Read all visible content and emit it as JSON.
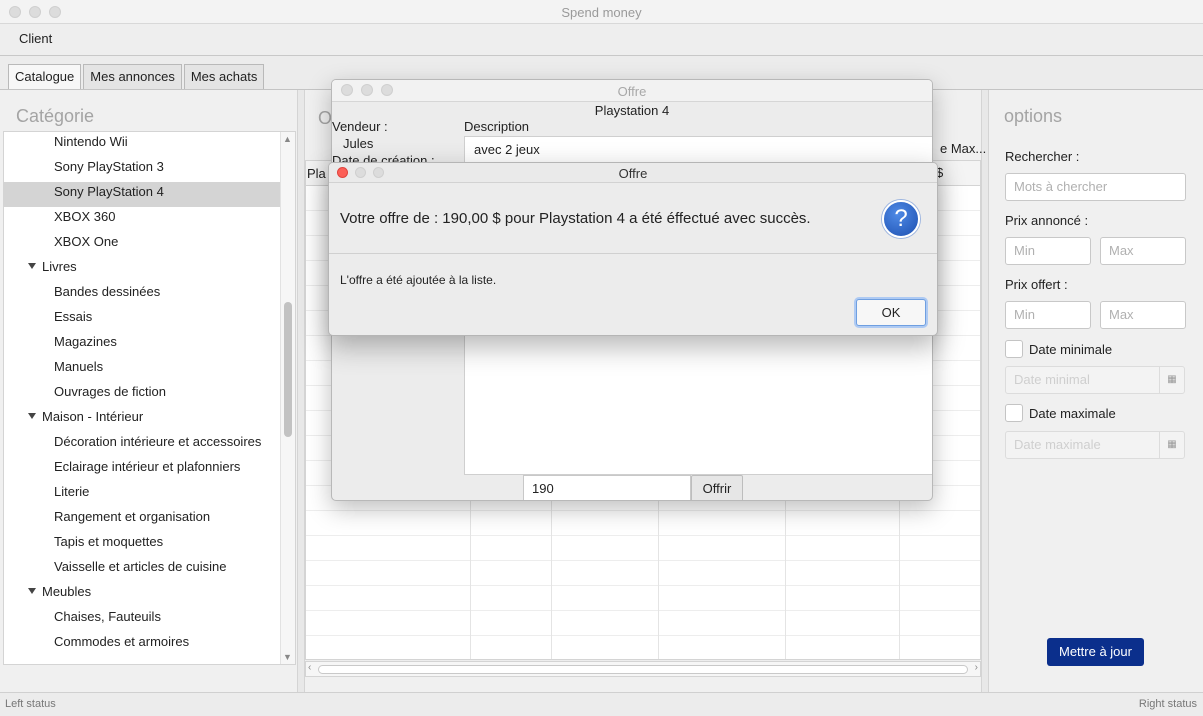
{
  "window": {
    "title": "Spend money"
  },
  "menu": {
    "client": "Client"
  },
  "tabs": [
    {
      "label": "Catalogue"
    },
    {
      "label": "Mes annonces"
    },
    {
      "label": "Mes achats"
    }
  ],
  "category": {
    "header": "Catégorie",
    "items": [
      {
        "label": "Nintendo Wii",
        "level": 1
      },
      {
        "label": "Sony PlayStation 3",
        "level": 1
      },
      {
        "label": "Sony PlayStation 4",
        "level": 1,
        "selected": true
      },
      {
        "label": "XBOX 360",
        "level": 1
      },
      {
        "label": "XBOX One",
        "level": 1
      },
      {
        "label": "Livres",
        "level": 0
      },
      {
        "label": "Bandes dessinées",
        "level": 1
      },
      {
        "label": "Essais",
        "level": 1
      },
      {
        "label": "Magazines",
        "level": 1
      },
      {
        "label": "Manuels",
        "level": 1
      },
      {
        "label": "Ouvrages de fiction",
        "level": 1
      },
      {
        "label": "Maison - Intérieur",
        "level": 0
      },
      {
        "label": "Décoration intérieure et accessoires",
        "level": 1
      },
      {
        "label": "Eclairage intérieur et plafonniers",
        "level": 1
      },
      {
        "label": "Literie",
        "level": 1
      },
      {
        "label": "Rangement et organisation",
        "level": 1
      },
      {
        "label": "Tapis et moquettes",
        "level": 1
      },
      {
        "label": "Vaisselle et articles de cuisine",
        "level": 1
      },
      {
        "label": "Meubles",
        "level": 0
      },
      {
        "label": "Chaises, Fauteuils",
        "level": 1
      },
      {
        "label": "Commodes et armoires",
        "level": 1
      }
    ]
  },
  "center": {
    "header_partial": "O",
    "col_partial": "Pla",
    "max_col_partial": "e Max...",
    "dollar_partial": "$"
  },
  "options": {
    "title": "options",
    "search_label": "Rechercher :",
    "search_placeholder": "Mots à chercher",
    "announced_label": "Prix annoncé :",
    "offered_label": "Prix offert :",
    "min_placeholder": "Min",
    "max_placeholder": "Max",
    "date_min_label": "Date minimale",
    "date_min_placeholder": "Date minimal",
    "date_max_label": "Date maximale",
    "date_max_placeholder": "Date maximale",
    "update_button": "Mettre à jour"
  },
  "status": {
    "left": "Left status",
    "right": "Right status"
  },
  "offer_window": {
    "title": "Offre",
    "product": "Playstation 4",
    "seller_label": "Vendeur :",
    "seller_value": "Jules",
    "date_label": "Date de création :",
    "description_label": "Description",
    "description_value": "avec 2 jeux",
    "offer_value": "190",
    "offer_button": "Offrir"
  },
  "alert": {
    "title": "Offre",
    "message": "Votre offre de : 190,00 $ pour Playstation 4  a été éffectué avec succès.",
    "content": "L'offre a été ajoutée à la liste.",
    "ok_button": "OK",
    "icon": "question-icon"
  }
}
